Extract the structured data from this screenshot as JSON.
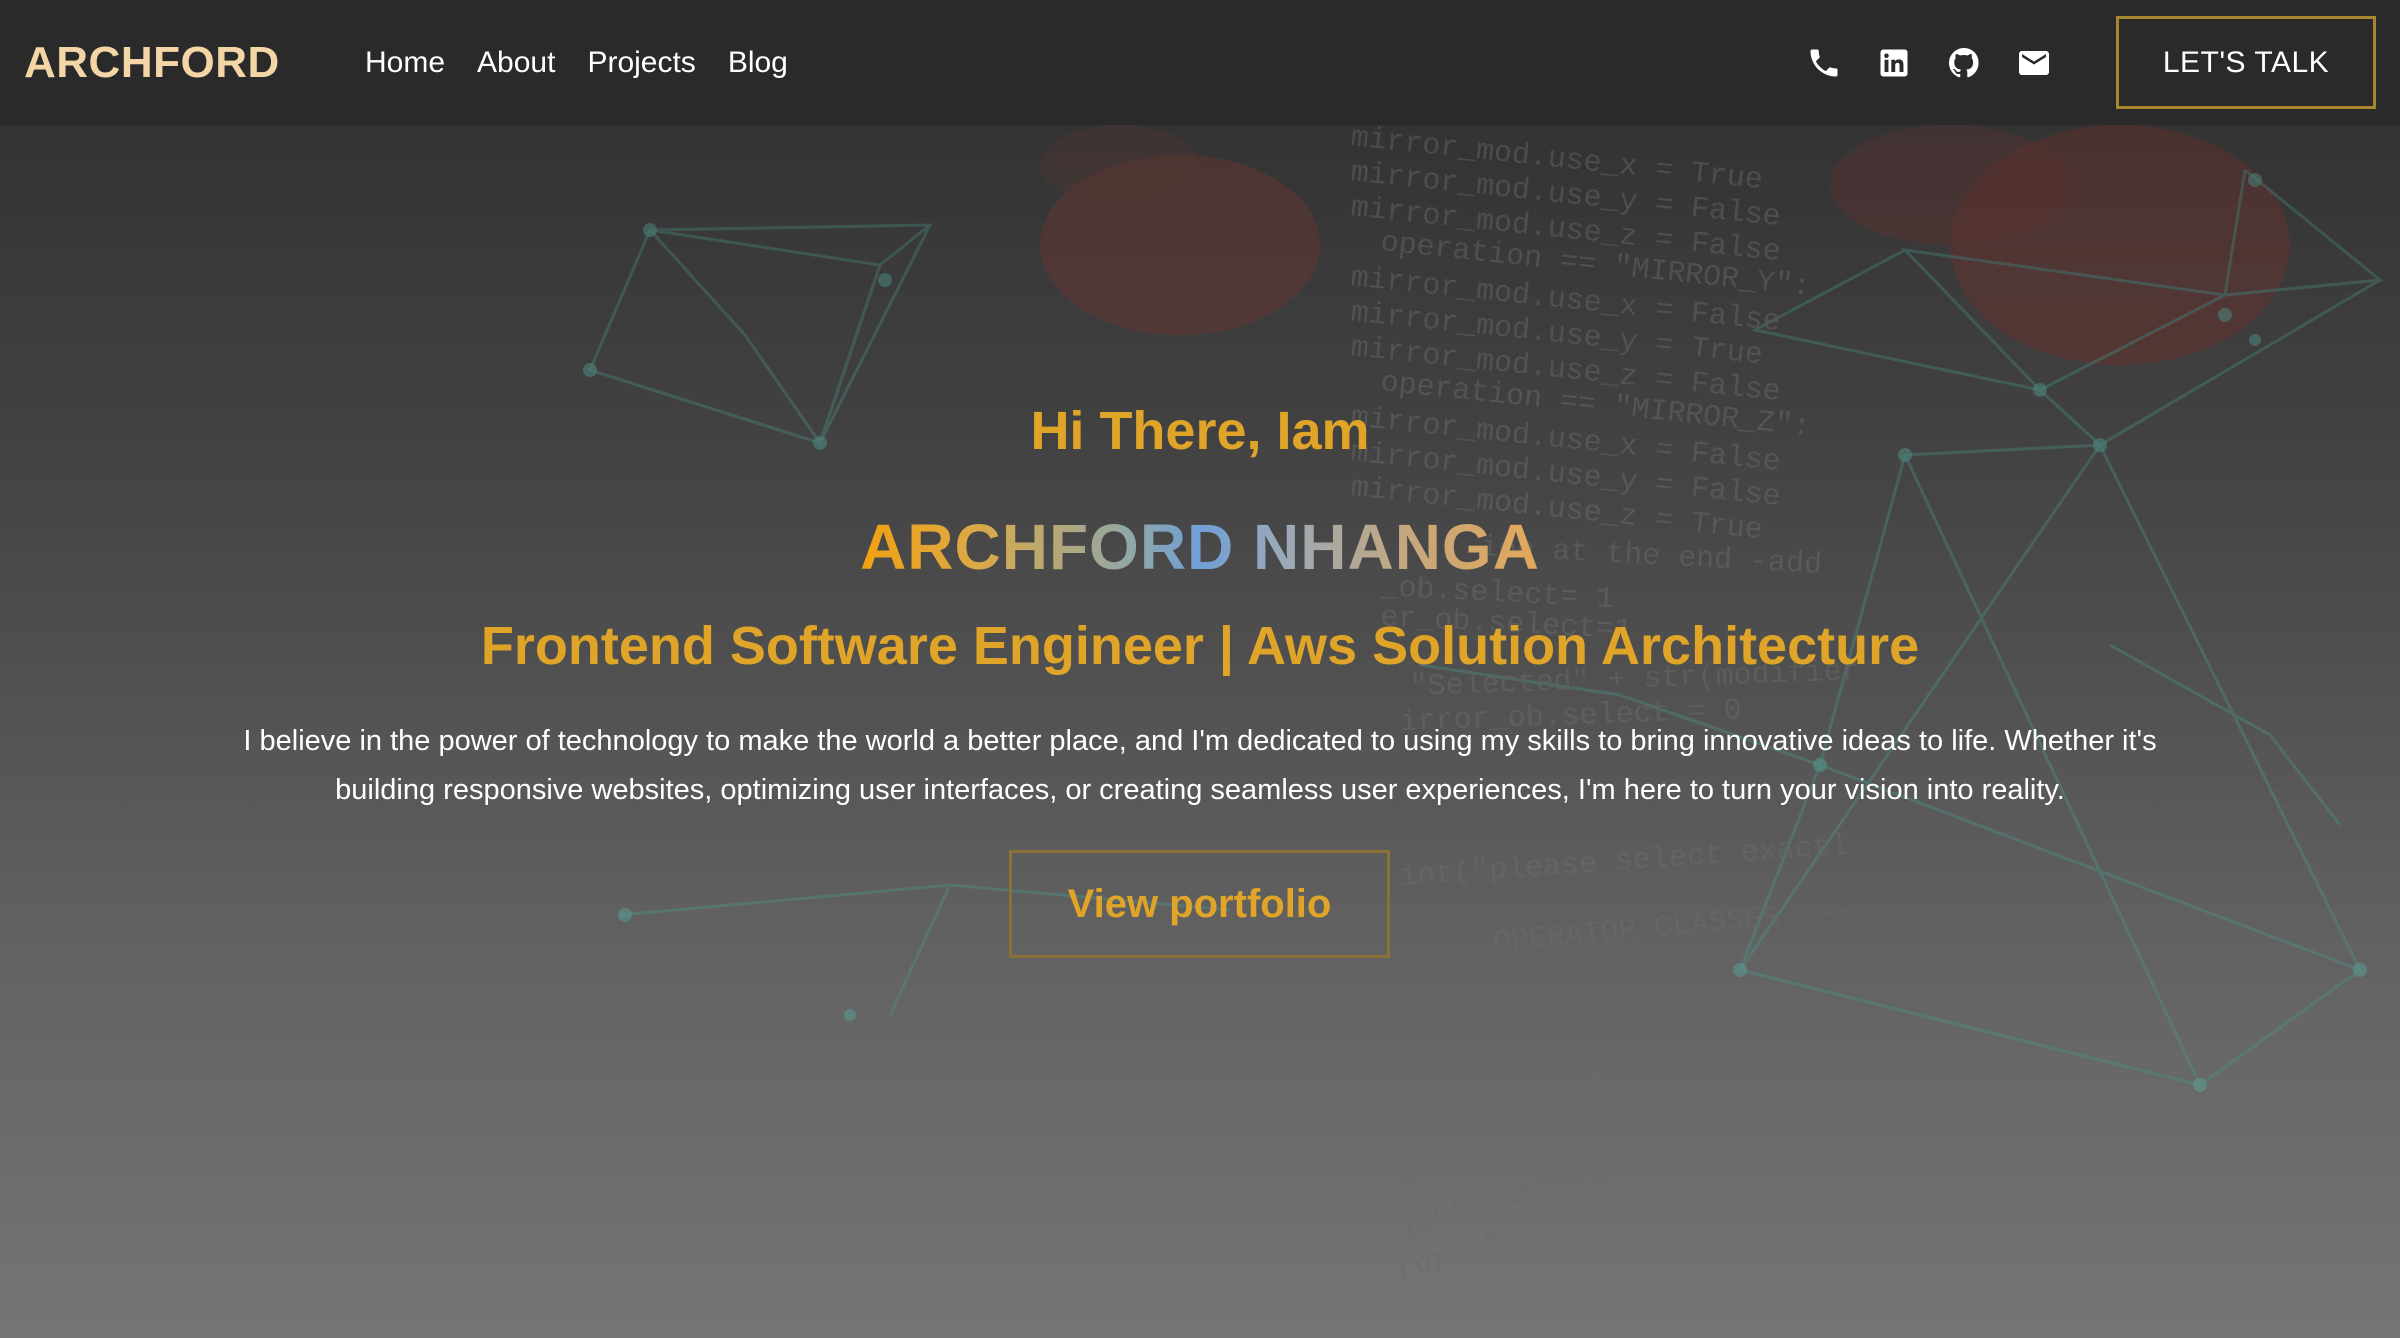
{
  "navbar": {
    "brand": "ARCHFORD",
    "links": [
      {
        "label": "Home"
      },
      {
        "label": "About"
      },
      {
        "label": "Projects"
      },
      {
        "label": "Blog"
      }
    ],
    "icons": [
      "phone-icon",
      "linkedin-icon",
      "github-icon",
      "mail-icon"
    ],
    "cta_label": "LET'S TALK"
  },
  "hero": {
    "greeting": "Hi There, Iam",
    "name": "ARCHFORD NHANGA",
    "role": "Frontend Software Engineer | Aws Solution Architecture",
    "bio": "I believe in the power of technology to make the world a better place, and I'm dedicated to using my skills to bring innovative ideas to life. Whether it's building responsive websites, optimizing user interfaces, or creating seamless user experiences, I'm here to turn your vision into reality.",
    "cta_label": "View portfolio"
  },
  "colors": {
    "accent": "#e0a528",
    "brand": "#f4d6a6",
    "nav_bg": "#2a2a2a",
    "button_border": "#a8862f"
  }
}
